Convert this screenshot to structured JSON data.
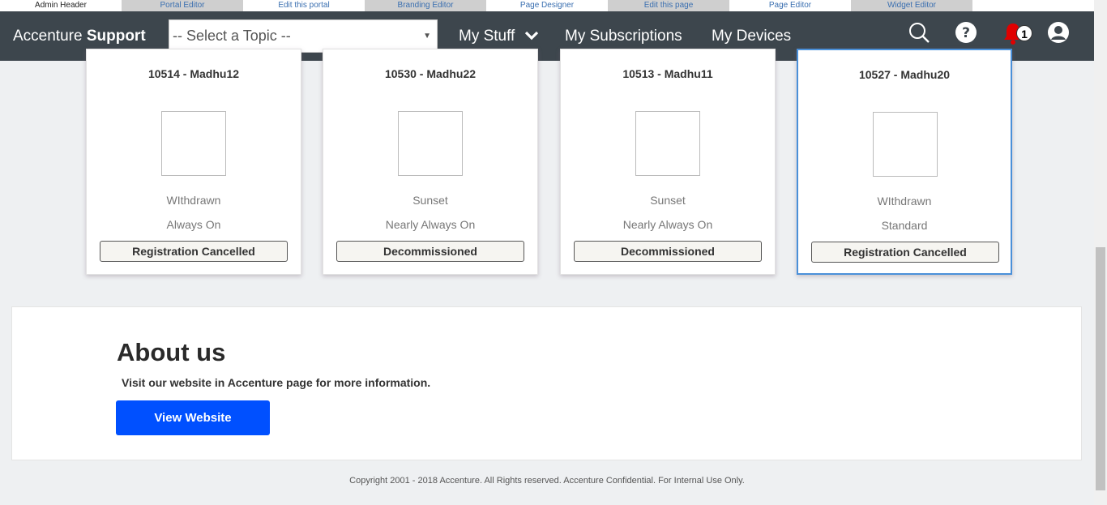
{
  "admin_bar": {
    "tabs": [
      "Admin Header",
      "Portal Editor",
      "Edit this portal",
      "Branding Editor",
      "Page Designer",
      "Edit this page",
      "Page Editor",
      "Widget Editor"
    ]
  },
  "header": {
    "brand_prefix": "Accenture",
    "brand_bold": "Support",
    "topic_select": "-- Select a Topic --",
    "nav": {
      "my_stuff": "My Stuff",
      "my_subscriptions": "My Subscriptions",
      "my_devices": "My Devices"
    },
    "notification_count": "1",
    "icons": [
      "search-icon",
      "help-icon",
      "bell-icon",
      "user-icon"
    ],
    "colors": {
      "bar": "#3d464d",
      "bell": "#e00000"
    }
  },
  "devices": [
    {
      "title": "10514 - Madhu12",
      "status": "WIthdrawn",
      "plan": "Always On",
      "action": "Registration Cancelled"
    },
    {
      "title": "10530 - Madhu22",
      "status": "Sunset",
      "plan": "Nearly Always On",
      "action": "Decommissioned"
    },
    {
      "title": "10513 - Madhu11",
      "status": "Sunset",
      "plan": "Nearly Always On",
      "action": "Decommissioned"
    },
    {
      "title": "10527 - Madhu20",
      "status": "WIthdrawn",
      "plan": "Standard",
      "action": "Registration Cancelled"
    }
  ],
  "about": {
    "title": "About us",
    "text": "Visit our website in Accenture page for more information.",
    "button": "View Website",
    "button_color": "#0050ff"
  },
  "footer": {
    "copyright": "Copyright 2001 - 2018 Accenture. All Rights reserved. Accenture Confidential. For Internal Use Only."
  }
}
